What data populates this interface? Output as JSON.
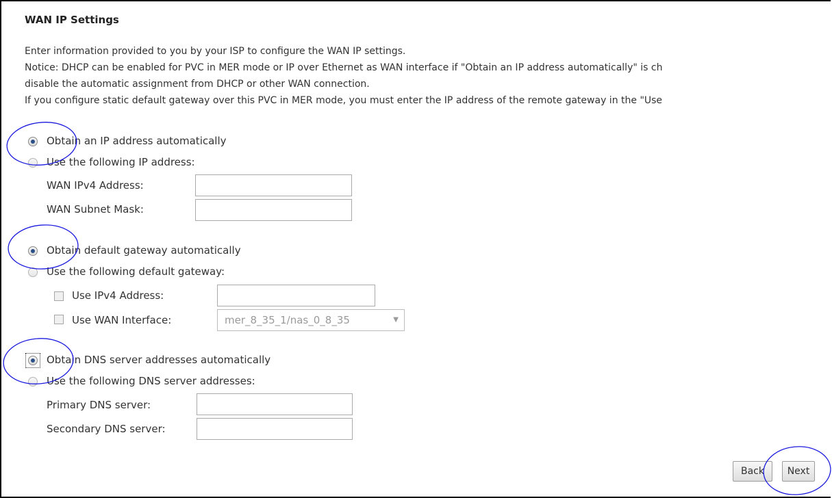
{
  "header": {
    "title": "WAN IP Settings"
  },
  "description": {
    "line1": "Enter information provided to you by your ISP to configure the WAN IP settings.",
    "line2": "Notice: DHCP can be enabled for PVC in MER mode or IP over Ethernet as WAN interface if \"Obtain an IP address automatically\" is ch",
    "line3": "disable the automatic assignment from DHCP or other WAN connection.",
    "line4": "If you configure static default gateway over this PVC in MER mode, you must enter the IP address of the remote gateway in the \"Use"
  },
  "ip": {
    "auto_label": "Obtain an IP address automatically",
    "manual_label": "Use the following IP address:",
    "ipv4_label": "WAN IPv4 Address:",
    "ipv4_value": "",
    "mask_label": "WAN Subnet Mask:",
    "mask_value": ""
  },
  "gateway": {
    "auto_label": "Obtain default gateway automatically",
    "manual_label": "Use the following default gateway:",
    "use_ipv4_label": "Use IPv4 Address:",
    "use_ipv4_value": "",
    "use_wan_label": "Use WAN Interface:",
    "wan_interface_selected": "mer_8_35_1/nas_0_8_35"
  },
  "dns": {
    "auto_label": "Obtain DNS server addresses automatically",
    "manual_label": "Use the following DNS server addresses:",
    "primary_label": "Primary DNS server:",
    "primary_value": "",
    "secondary_label": "Secondary DNS server:",
    "secondary_value": ""
  },
  "actions": {
    "back_label": "Back",
    "next_label": "Next"
  },
  "annotation_color": "#1a1adf",
  "icons": {
    "select_arrow": "chevron-down-icon"
  }
}
